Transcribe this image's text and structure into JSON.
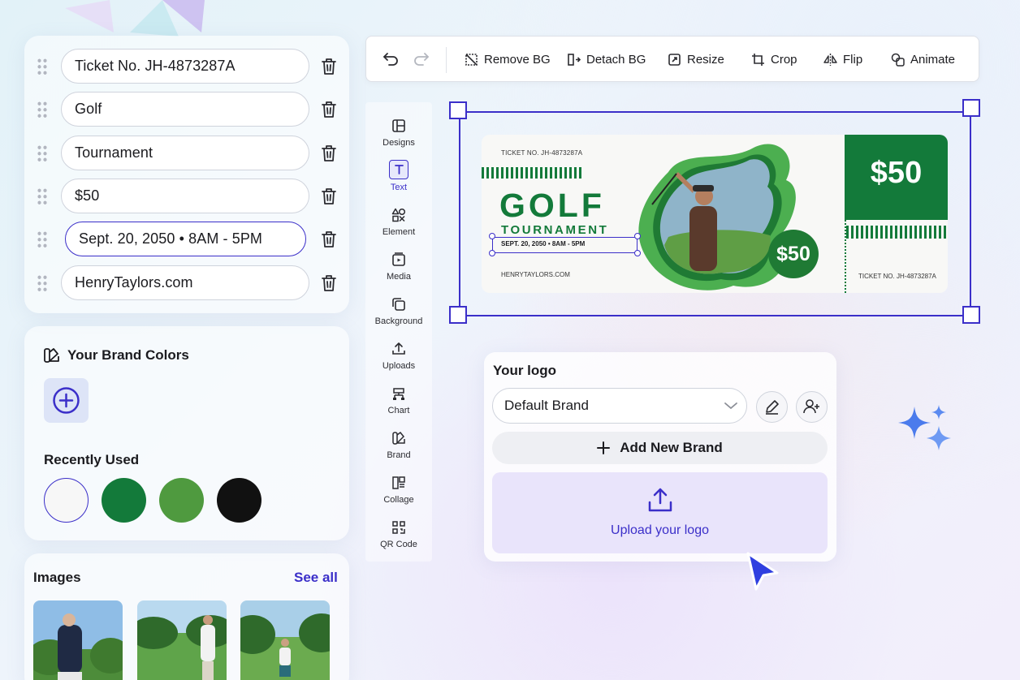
{
  "fields": [
    {
      "value": "Ticket No. JH-4873287A"
    },
    {
      "value": "Golf"
    },
    {
      "value": "Tournament"
    },
    {
      "value": "$50"
    },
    {
      "value": "Sept. 20, 2050 • 8AM - 5PM"
    },
    {
      "value": "HenryTaylors.com"
    }
  ],
  "brand_colors": {
    "title": "Your Brand Colors",
    "recent_title": "Recently Used",
    "swatches": [
      "#f7f7f7",
      "#137a3a",
      "#4f9a3f",
      "#111111"
    ]
  },
  "images": {
    "title": "Images",
    "see_all": "See all"
  },
  "toolbar": {
    "remove_bg": "Remove BG",
    "detach_bg": "Detach BG",
    "resize": "Resize",
    "crop": "Crop",
    "flip": "Flip",
    "animate": "Animate"
  },
  "sidenav": {
    "designs": "Designs",
    "text": "Text",
    "element": "Element",
    "media": "Media",
    "background": "Background",
    "uploads": "Uploads",
    "chart": "Chart",
    "brand": "Brand",
    "collage": "Collage",
    "qr_code": "QR Code"
  },
  "ticket": {
    "ticket_no_top": "TICKET NO. JH-4873287A",
    "title": "GOLF",
    "subtitle": "TOURNAMENT",
    "date": "SEPT. 20, 2050 • 8AM - 5PM",
    "website": "HENRYTAYLORS.COM",
    "price_big": "$50",
    "price_badge": "$50",
    "ticket_no_stub": "TICKET NO. JH-4873287A",
    "green": "#137a3a"
  },
  "logo": {
    "title": "Your logo",
    "selected_brand": "Default Brand",
    "add_brand": "Add New Brand",
    "upload": "Upload your logo"
  },
  "accent": "#3b2fc9"
}
